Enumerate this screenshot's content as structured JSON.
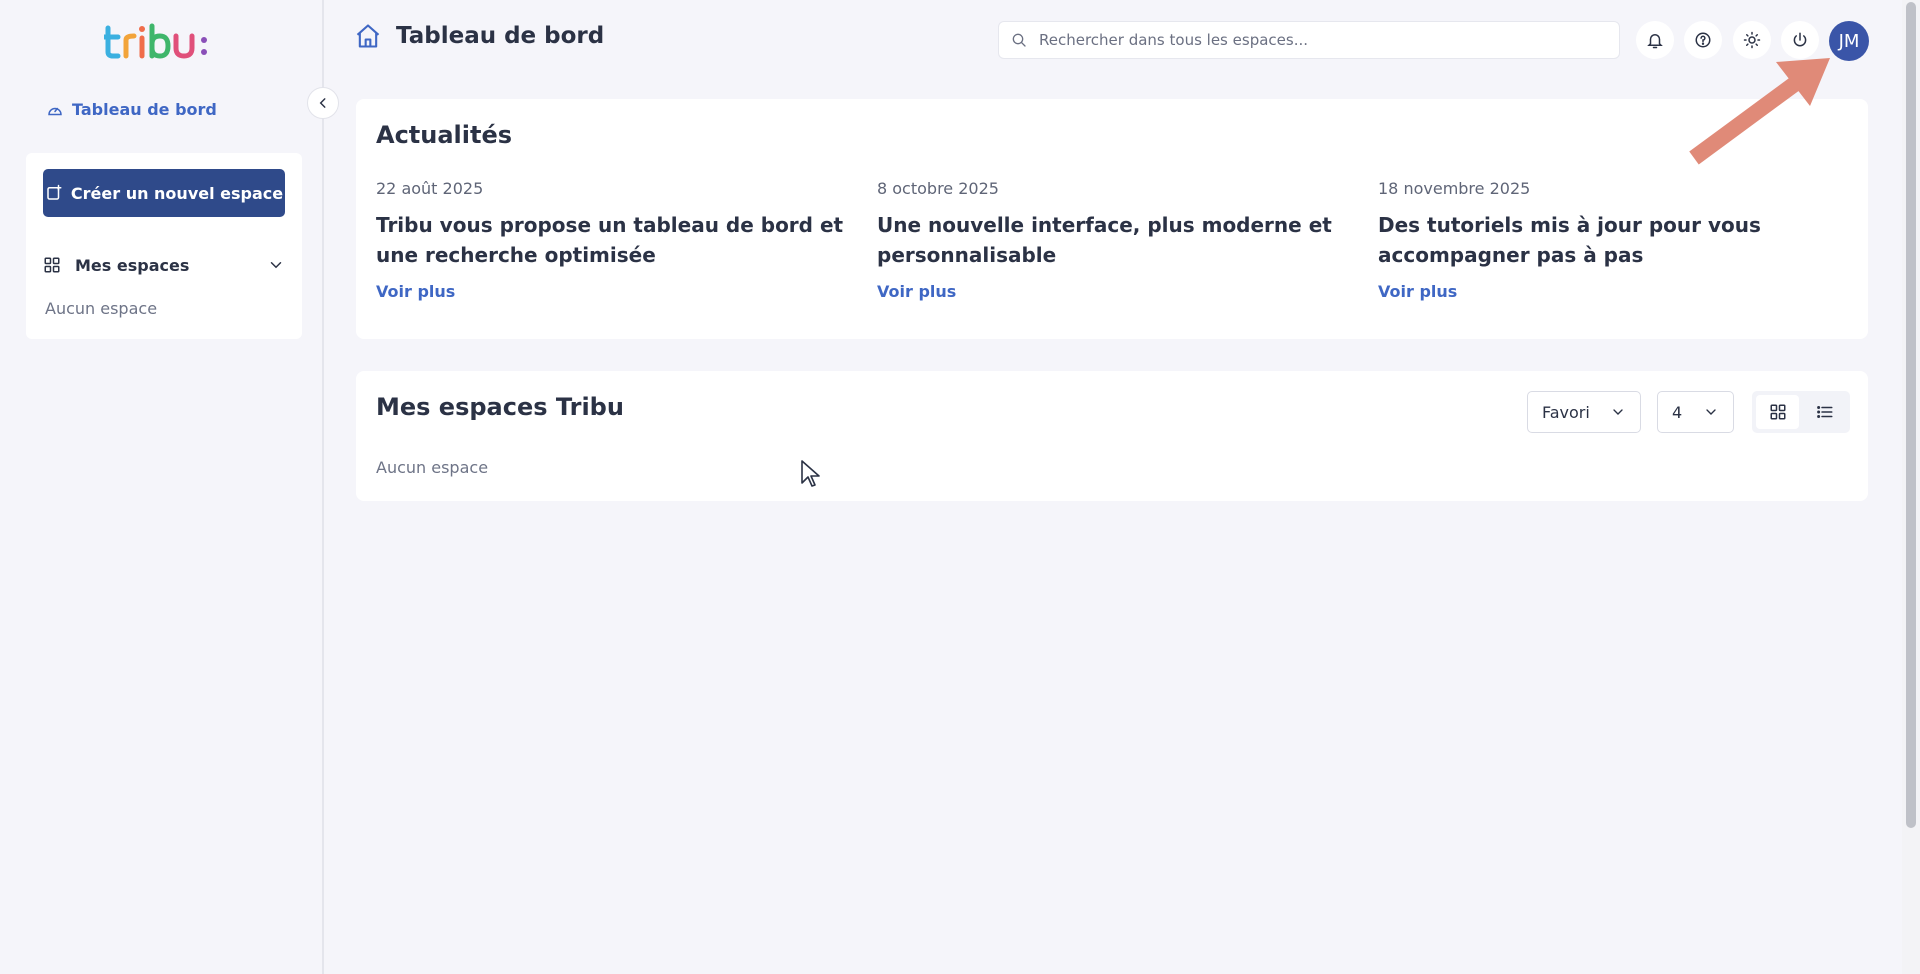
{
  "sidebar": {
    "logo_text": "tribu:",
    "dashboard_link": "Tableau de bord",
    "create_button": "Créer un nouvel espace",
    "my_spaces_label": "Mes espaces",
    "empty_text": "Aucun espace"
  },
  "header": {
    "title": "Tableau de bord",
    "search_placeholder": "Rechercher dans tous les espaces...",
    "avatar_initials": "JM"
  },
  "news": {
    "title": "Actualités",
    "items": [
      {
        "date": "22 août 2025",
        "headline": "Tribu vous propose un tableau de bord et une recherche optimisée",
        "link": "Voir plus"
      },
      {
        "date": "8 octobre 2025",
        "headline": "Une nouvelle interface, plus moderne et personnalisable",
        "link": "Voir plus"
      },
      {
        "date": "18 novembre 2025",
        "headline": "Des tutoriels mis à jour pour vous accompagner pas à pas",
        "link": "Voir plus"
      }
    ]
  },
  "spaces": {
    "title": "Mes espaces Tribu",
    "sort_value": "Favori",
    "count_value": "4",
    "empty_text": "Aucun espace"
  },
  "colors": {
    "primary": "#2f4a8a",
    "link": "#3f67c4",
    "avatar": "#3a55a8",
    "annotation_arrow": "#e08a78"
  }
}
